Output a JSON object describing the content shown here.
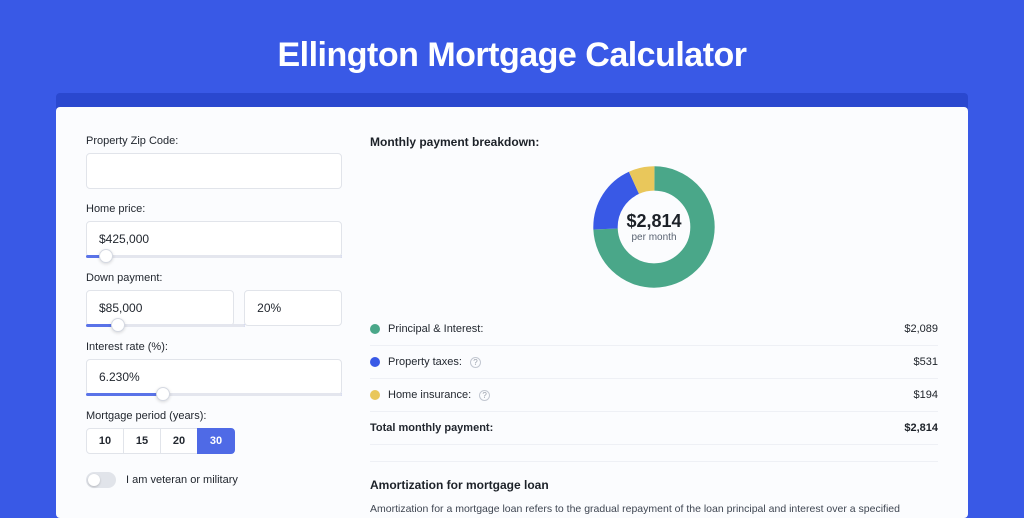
{
  "hero": {
    "title": "Ellington Mortgage Calculator"
  },
  "form": {
    "zip_label": "Property Zip Code:",
    "zip_value": "",
    "home_price_label": "Home price:",
    "home_price_value": "$425,000",
    "home_price_slider_pct": 8,
    "down_payment_label": "Down payment:",
    "down_payment_value": "$85,000",
    "down_payment_pct_value": "20%",
    "down_payment_slider_pct": 20,
    "interest_label": "Interest rate (%):",
    "interest_value": "6.230%",
    "interest_slider_pct": 30,
    "period_label": "Mortgage period (years):",
    "periods": [
      "10",
      "15",
      "20",
      "30"
    ],
    "period_selected": "30",
    "veteran_label": "I am veteran or military",
    "veteran_on": false
  },
  "breakdown": {
    "title": "Monthly payment breakdown:",
    "center_amount": "$2,814",
    "center_sub": "per month",
    "items": [
      {
        "label": "Principal & Interest:",
        "value": "$2,089",
        "color": "#4aa789",
        "has_info": false
      },
      {
        "label": "Property taxes:",
        "value": "$531",
        "color": "#3959e6",
        "has_info": true
      },
      {
        "label": "Home insurance:",
        "value": "$194",
        "color": "#e9c75b",
        "has_info": true
      }
    ],
    "total_label": "Total monthly payment:",
    "total_value": "$2,814"
  },
  "amort": {
    "title": "Amortization for mortgage loan",
    "text": "Amortization for a mortgage loan refers to the gradual repayment of the loan principal and interest over a specified"
  },
  "chart_data": {
    "type": "pie",
    "title": "Monthly payment breakdown",
    "series": [
      {
        "name": "Principal & Interest",
        "value": 2089,
        "color": "#4aa789"
      },
      {
        "name": "Property taxes",
        "value": 531,
        "color": "#3959e6"
      },
      {
        "name": "Home insurance",
        "value": 194,
        "color": "#e9c75b"
      }
    ],
    "total": 2814,
    "center_label": "$2,814 per month"
  }
}
